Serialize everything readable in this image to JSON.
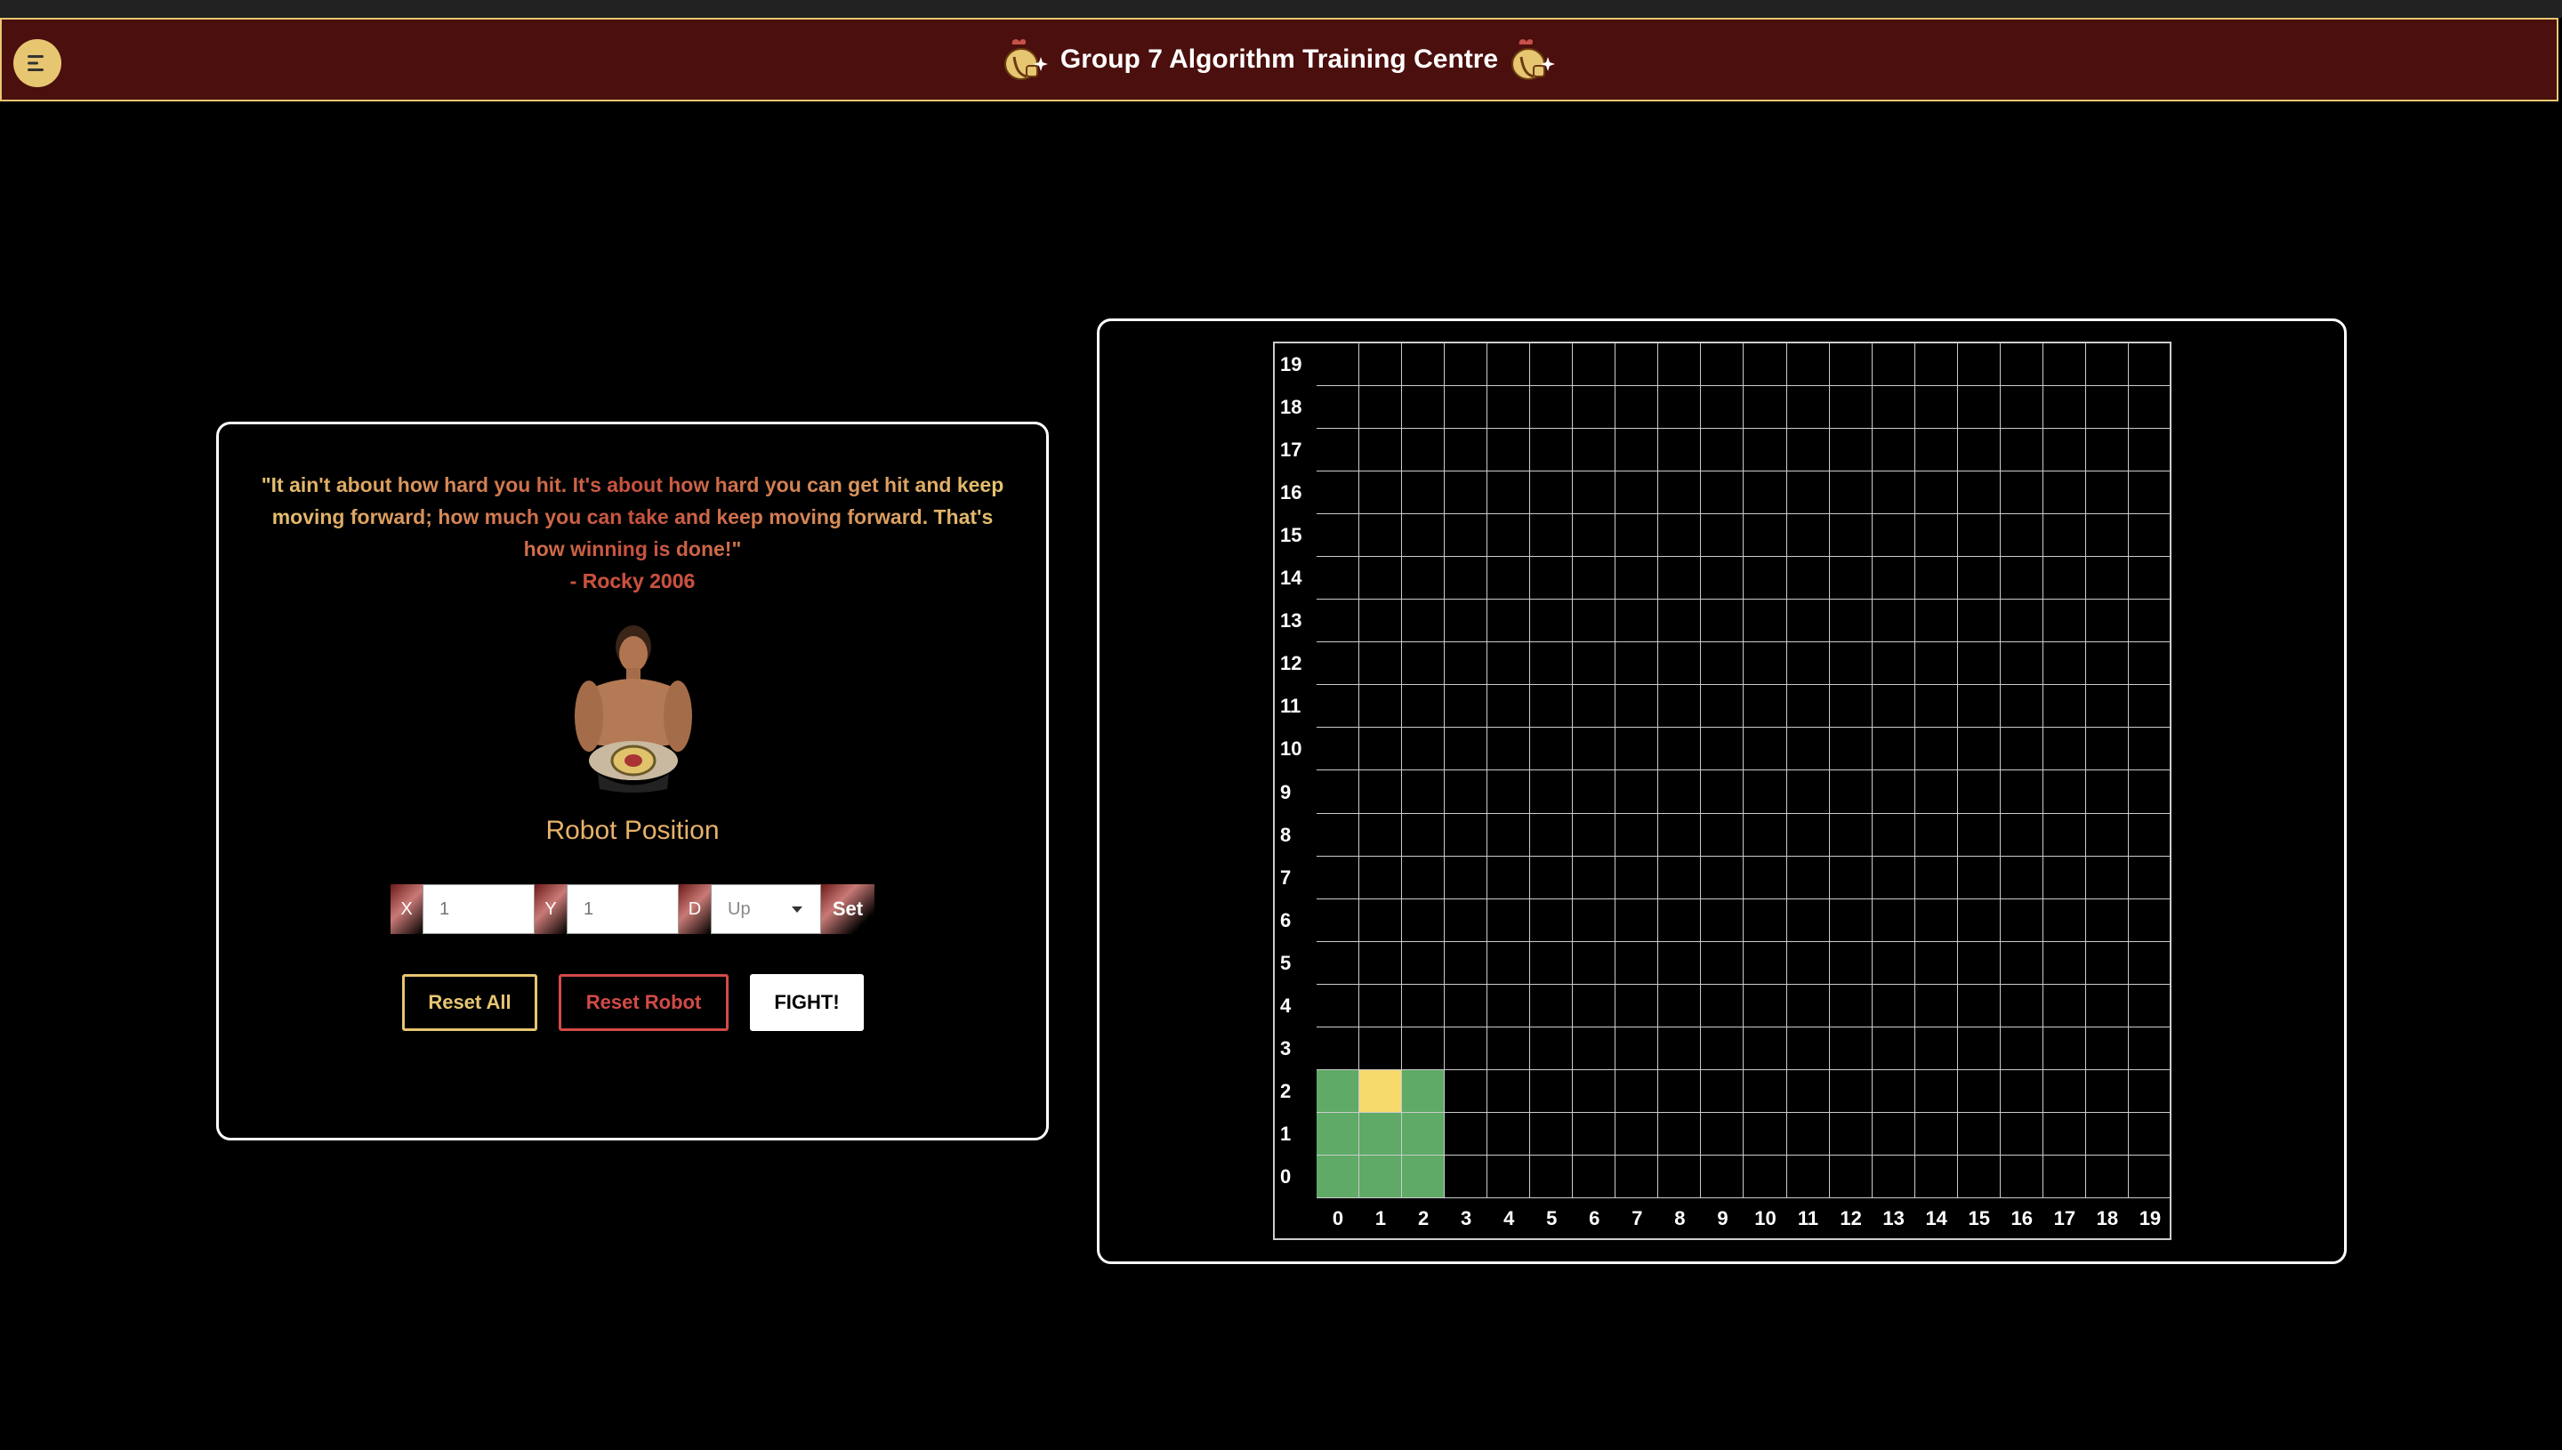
{
  "header": {
    "title": "Group 7 Algorithm Training Centre",
    "menu_icon": "menu-icon",
    "title_icon": "boxing-glove-icon",
    "background": "#4b0f0d",
    "accent": "#e7c671"
  },
  "left_panel": {
    "quote": "\"It ain't about how hard you hit. It's about how hard you can get hit and keep moving forward; how much you can take and keep moving forward. That's how winning is done!\"",
    "quote_author": "- Rocky 2006",
    "image_alt": "boxer-with-championship-belt",
    "robot_position_title": "Robot Position",
    "form": {
      "x_label": "X",
      "x_placeholder": "1",
      "y_label": "Y",
      "y_placeholder": "1",
      "d_label": "D",
      "direction_selected": "Up",
      "set_label": "Set"
    },
    "buttons": {
      "reset_all": "Reset All",
      "reset_robot": "Reset Robot",
      "fight": "FIGHT!"
    }
  },
  "grid": {
    "size": 20,
    "robot_cells": [
      [
        0,
        0
      ],
      [
        1,
        0
      ],
      [
        2,
        0
      ],
      [
        0,
        1
      ],
      [
        1,
        1
      ],
      [
        2,
        1
      ],
      [
        0,
        2
      ],
      [
        2,
        2
      ]
    ],
    "robot_head_cell": [
      1,
      2
    ],
    "robot_color": "#5eaa66",
    "head_color": "#f5d96b",
    "y_labels": [
      "19",
      "18",
      "17",
      "16",
      "15",
      "14",
      "13",
      "12",
      "11",
      "10",
      "9",
      "8",
      "7",
      "6",
      "5",
      "4",
      "3",
      "2",
      "1",
      "0"
    ],
    "x_labels": [
      "0",
      "1",
      "2",
      "3",
      "4",
      "5",
      "6",
      "7",
      "8",
      "9",
      "10",
      "11",
      "12",
      "13",
      "14",
      "15",
      "16",
      "17",
      "18",
      "19"
    ]
  }
}
